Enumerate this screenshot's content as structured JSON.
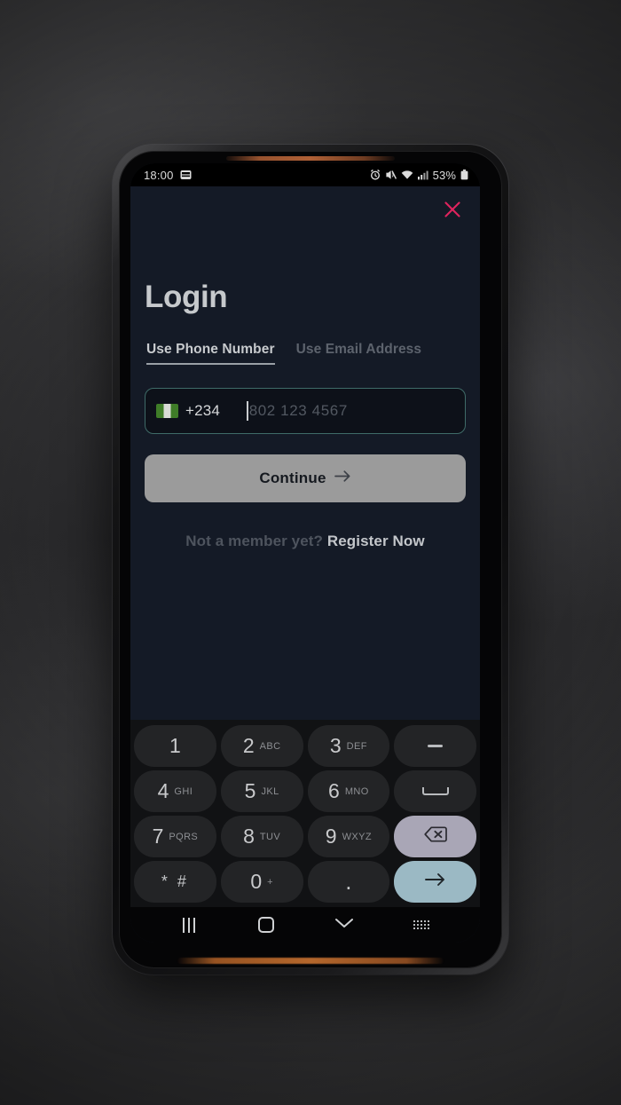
{
  "status_bar": {
    "time": "18:00",
    "left_icon": "keyboard-notification-icon",
    "icons": [
      "alarm-icon",
      "mute-icon",
      "wifi-icon",
      "signal-icon"
    ],
    "battery_percent": "53%"
  },
  "app": {
    "close_icon": "close-icon",
    "close_color": "#e0245e",
    "title": "Login",
    "tabs": [
      {
        "label": "Use Phone Number",
        "active": true
      },
      {
        "label": "Use Email Address",
        "active": false
      }
    ],
    "phone_field": {
      "flag": "nigeria-flag-icon",
      "country_code": "+234",
      "placeholder": "802 123 4567",
      "value": "",
      "border_color": "#3f6b68"
    },
    "continue_button": {
      "label": "Continue",
      "arrow": "arrow-right-icon",
      "background": "#9b9b9b"
    },
    "register": {
      "prompt": "Not a member yet? ",
      "link": "Register Now"
    }
  },
  "keypad": {
    "rows": [
      [
        {
          "digit": "1",
          "letters": ""
        },
        {
          "digit": "2",
          "letters": "ABC"
        },
        {
          "digit": "3",
          "letters": "DEF"
        },
        {
          "type": "dash",
          "name": "dash-key"
        }
      ],
      [
        {
          "digit": "4",
          "letters": "GHI"
        },
        {
          "digit": "5",
          "letters": "JKL"
        },
        {
          "digit": "6",
          "letters": "MNO"
        },
        {
          "type": "space",
          "name": "space-key"
        }
      ],
      [
        {
          "digit": "7",
          "letters": "PQRS"
        },
        {
          "digit": "8",
          "letters": "TUV"
        },
        {
          "digit": "9",
          "letters": "WXYZ"
        },
        {
          "type": "backspace",
          "name": "backspace-key"
        }
      ],
      [
        {
          "symbol": "* #",
          "name": "star-hash-key"
        },
        {
          "digit": "0",
          "letters": "+"
        },
        {
          "symbol": ".",
          "name": "period-key"
        },
        {
          "type": "enter",
          "name": "enter-key"
        }
      ]
    ],
    "backspace_color": "#a9a6b6",
    "enter_color": "#9bb9c4"
  },
  "nav_bar": {
    "recents": "recents-icon",
    "home": "home-icon",
    "dismiss_keyboard": "chevron-down-icon",
    "keyboard_switch": "keyboard-switch-icon"
  }
}
